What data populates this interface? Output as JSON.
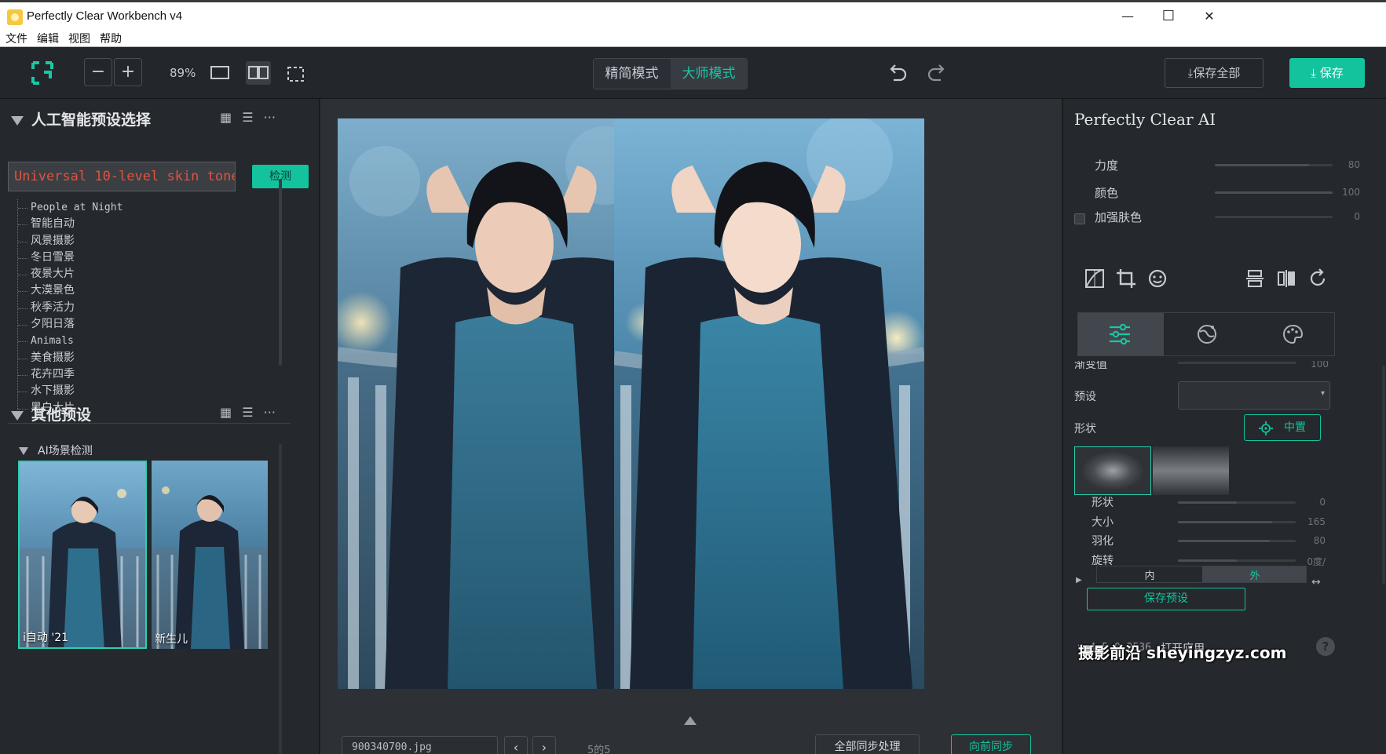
{
  "window": {
    "title": "Perfectly Clear Workbench v4",
    "minimize": "—",
    "maximize": "☐",
    "close": "✕"
  },
  "menu": [
    "文件",
    "编辑",
    "视图",
    "帮助"
  ],
  "toolbar": {
    "zoom_out": "−",
    "zoom_in": "+",
    "zoom_level": "89%",
    "modes": [
      {
        "label": "精简模式",
        "active": false
      },
      {
        "label": "大师模式",
        "active": true
      }
    ],
    "save_all_label": "保存全部",
    "save_label": "保存",
    "accent_color": "#13c39d"
  },
  "left_panel": {
    "ai_presets_title": "人工智能预设选择",
    "preset_input_value": "Universal 10-level skin tone",
    "detect_label": "检测",
    "presets": [
      "People at Night",
      "智能自动",
      "风景摄影",
      "冬日雪景",
      "夜景大片",
      "大漠景色",
      "秋季活力",
      "夕阳日落",
      "Animals",
      "美食摄影",
      "花卉四季",
      "水下摄影",
      "黑白大片"
    ],
    "other_presets_title": "其他预设",
    "ai_scene_label": "AI场景检测",
    "thumbnails": [
      {
        "label": "i自动 '21",
        "selected": true
      },
      {
        "label": "新生儿",
        "selected": false
      }
    ]
  },
  "center": {
    "file_name": "900340700.jpg",
    "page_info": "5的5",
    "sync_all_label": "全部同步处理",
    "sync_forward_label": "向前同步"
  },
  "right_panel": {
    "title": "Perfectly Clear AI",
    "sliders_top": [
      {
        "label": "力度",
        "value": "80",
        "fraction": 0.8
      },
      {
        "label": "颜色",
        "value": "100",
        "fraction": 1.0
      },
      {
        "label": "加强肤色",
        "value": "0",
        "fraction": 0.0
      }
    ],
    "gradient_label": "渐变值",
    "gradient_value": "100",
    "preset_label": "预设",
    "shape_label": "形状",
    "center_label": "中置",
    "shape_sliders": [
      {
        "label": "形状",
        "value": "0",
        "fraction": 0.5
      },
      {
        "label": "大小",
        "value": "165",
        "fraction": 0.8
      },
      {
        "label": "羽化",
        "value": "80",
        "fraction": 0.78
      },
      {
        "label": "旋转",
        "value": "0度/",
        "fraction": 0.5
      }
    ],
    "segments": [
      "内",
      "外"
    ],
    "save_preset_label": "保存预设",
    "version": "v:4.5.0.2536",
    "open_app_label": "打开应用",
    "help_label": "?"
  },
  "watermark": "摄影前沿 sheyingzyz.com"
}
